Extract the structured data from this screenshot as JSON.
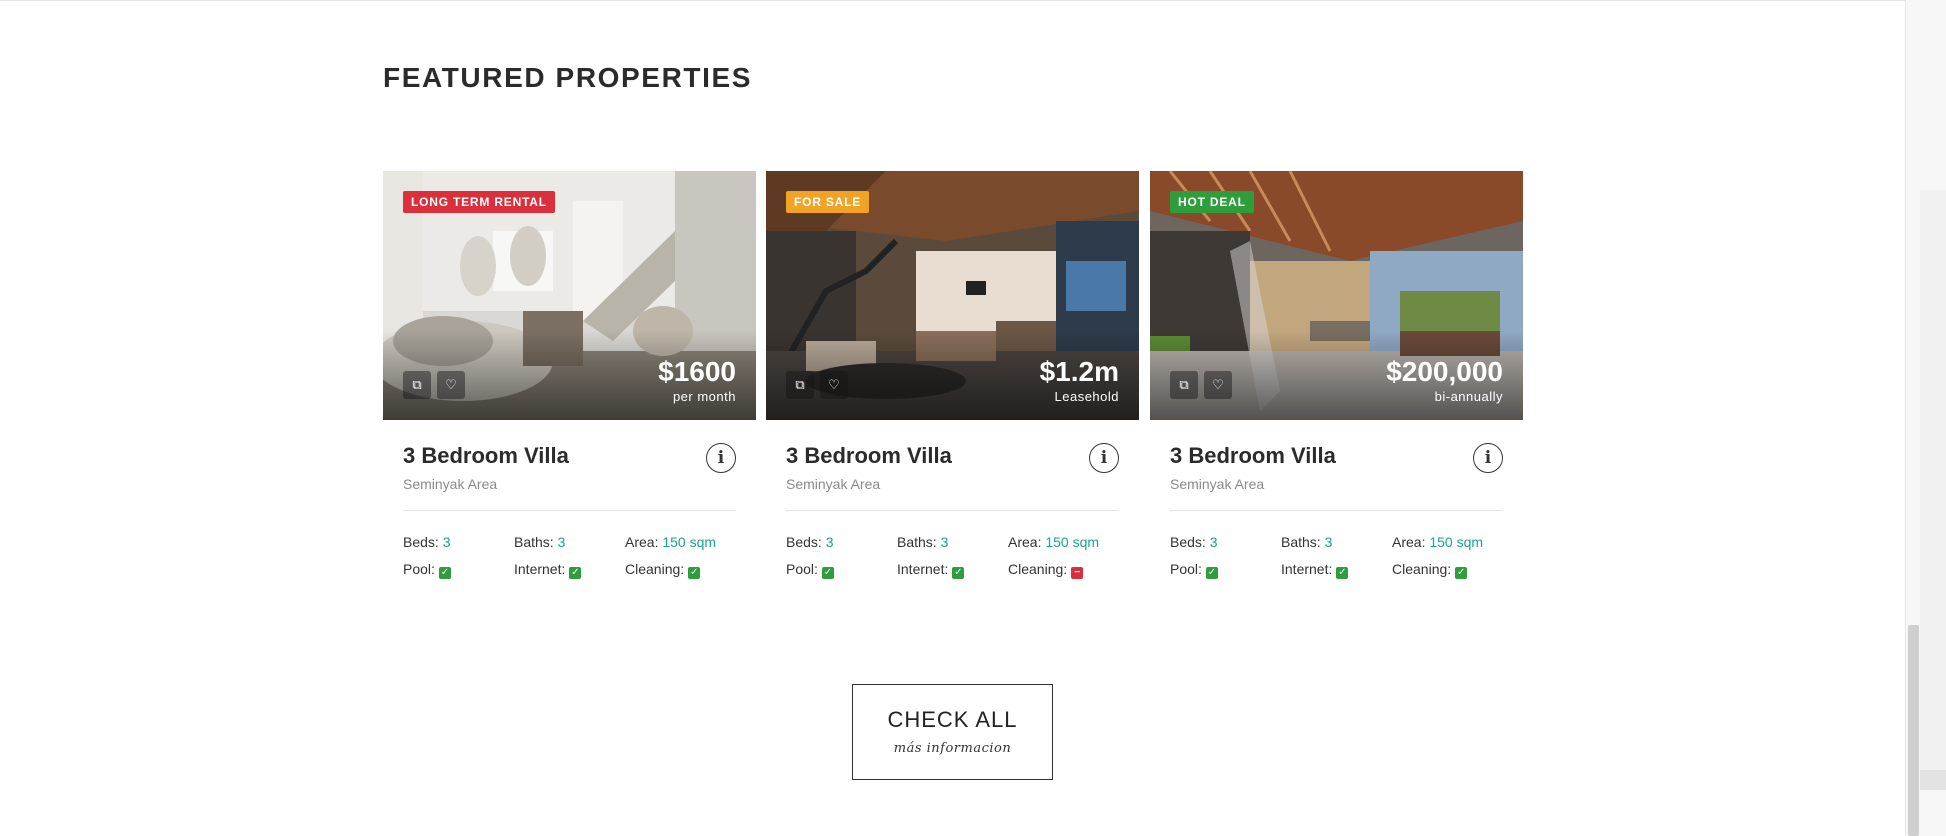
{
  "section": {
    "title": "FEATURED PROPERTIES"
  },
  "colors": {
    "accent_value": "#1aa38a",
    "check_yes": "#2e9e3c",
    "check_no": "#d9303c",
    "badge_long_term": "#d9303c",
    "badge_for_sale": "#f0a324",
    "badge_hot_deal": "#2e9e3c"
  },
  "properties": [
    {
      "badge": "LONG TERM RENTAL",
      "badge_color": "#d9303c",
      "price": "$1600",
      "price_sub": "per month",
      "title": "3 Bedroom Villa",
      "area_name": "Seminyak Area",
      "beds_label": "Beds:",
      "beds": "3",
      "baths_label": "Baths:",
      "baths": "3",
      "area_label": "Area:",
      "area": "150 sqm",
      "pool_label": "Pool:",
      "pool": true,
      "internet_label": "Internet:",
      "internet": true,
      "cleaning_label": "Cleaning:",
      "cleaning": true
    },
    {
      "badge": "FOR SALE",
      "badge_color": "#f0a324",
      "price": "$1.2m",
      "price_sub": "Leasehold",
      "title": "3 Bedroom Villa",
      "area_name": "Seminyak Area",
      "beds_label": "Beds:",
      "beds": "3",
      "baths_label": "Baths:",
      "baths": "3",
      "area_label": "Area:",
      "area": "150 sqm",
      "pool_label": "Pool:",
      "pool": true,
      "internet_label": "Internet:",
      "internet": true,
      "cleaning_label": "Cleaning:",
      "cleaning": false
    },
    {
      "badge": "HOT DEAL",
      "badge_color": "#2e9e3c",
      "price": "$200,000",
      "price_sub": "bi-annually",
      "title": "3 Bedroom Villa",
      "area_name": "Seminyak Area",
      "beds_label": "Beds:",
      "beds": "3",
      "baths_label": "Baths:",
      "baths": "3",
      "area_label": "Area:",
      "area": "150 sqm",
      "pool_label": "Pool:",
      "pool": true,
      "internet_label": "Internet:",
      "internet": true,
      "cleaning_label": "Cleaning:",
      "cleaning": true
    }
  ],
  "icons": {
    "copy": "copy-icon",
    "favorite": "heart-icon",
    "info": "info-icon",
    "check": "check-icon",
    "minus": "minus-icon"
  },
  "cta": {
    "title": "CHECK ALL",
    "subtitle": "más informacion"
  }
}
